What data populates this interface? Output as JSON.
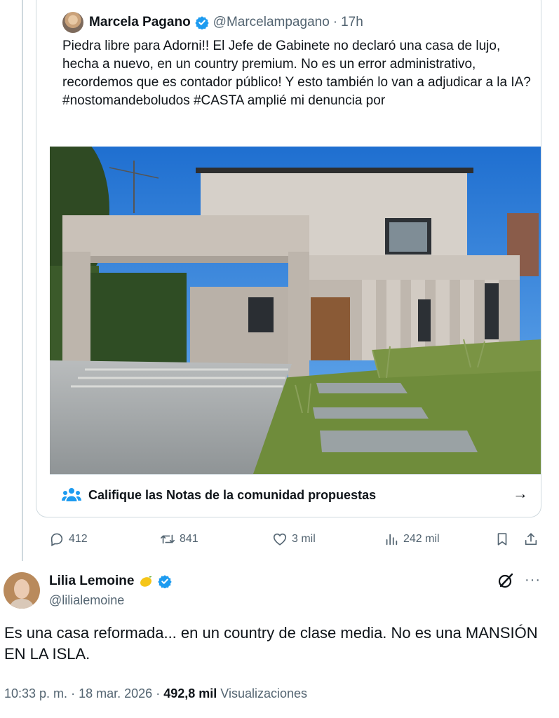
{
  "quoted_post": {
    "author_name": "Marcela Pagano",
    "author_handle": "@Marcelampagano",
    "separator": "·",
    "time": "17h",
    "text": "Piedra libre para Adorni!! El Jefe de Gabinete no declaró una casa de lujo, hecha a nuevo, en un country premium. No es un error administrativo, recordemos que es contador público! Y esto también lo van a adjudicar a la IA? #nostomandeboludos #CASTA amplié mi denuncia por",
    "community_notes_label": "Califique las Notas de la comunidad propuestas",
    "arrow": "→"
  },
  "actions": {
    "replies": "412",
    "reposts": "841",
    "likes": "3 mil",
    "views": "242 mil"
  },
  "post": {
    "author_name": "Lilia Lemoine",
    "author_handle": "@lilialemoine",
    "text": "Es una casa reformada... en un country de clase media. No es una MANSIÓN EN LA ISLA.",
    "time": "10:33 p. m.",
    "dot1": "·",
    "date": "18 mar. 2026",
    "dot2": "·",
    "views_count": "492,8 mil",
    "views_label": "Visualizaciones",
    "more": "···"
  },
  "icons": [
    "verified-badge-icon",
    "community-notes-icon",
    "reply-icon",
    "repost-icon",
    "like-icon",
    "views-icon",
    "bookmark-icon",
    "share-icon",
    "grok-icon",
    "more-icon",
    "lemon-emoji-icon"
  ],
  "colors": {
    "accent": "#1d9bf0",
    "text": "#0f1419",
    "muted": "#536471",
    "border": "#cfd9de"
  }
}
